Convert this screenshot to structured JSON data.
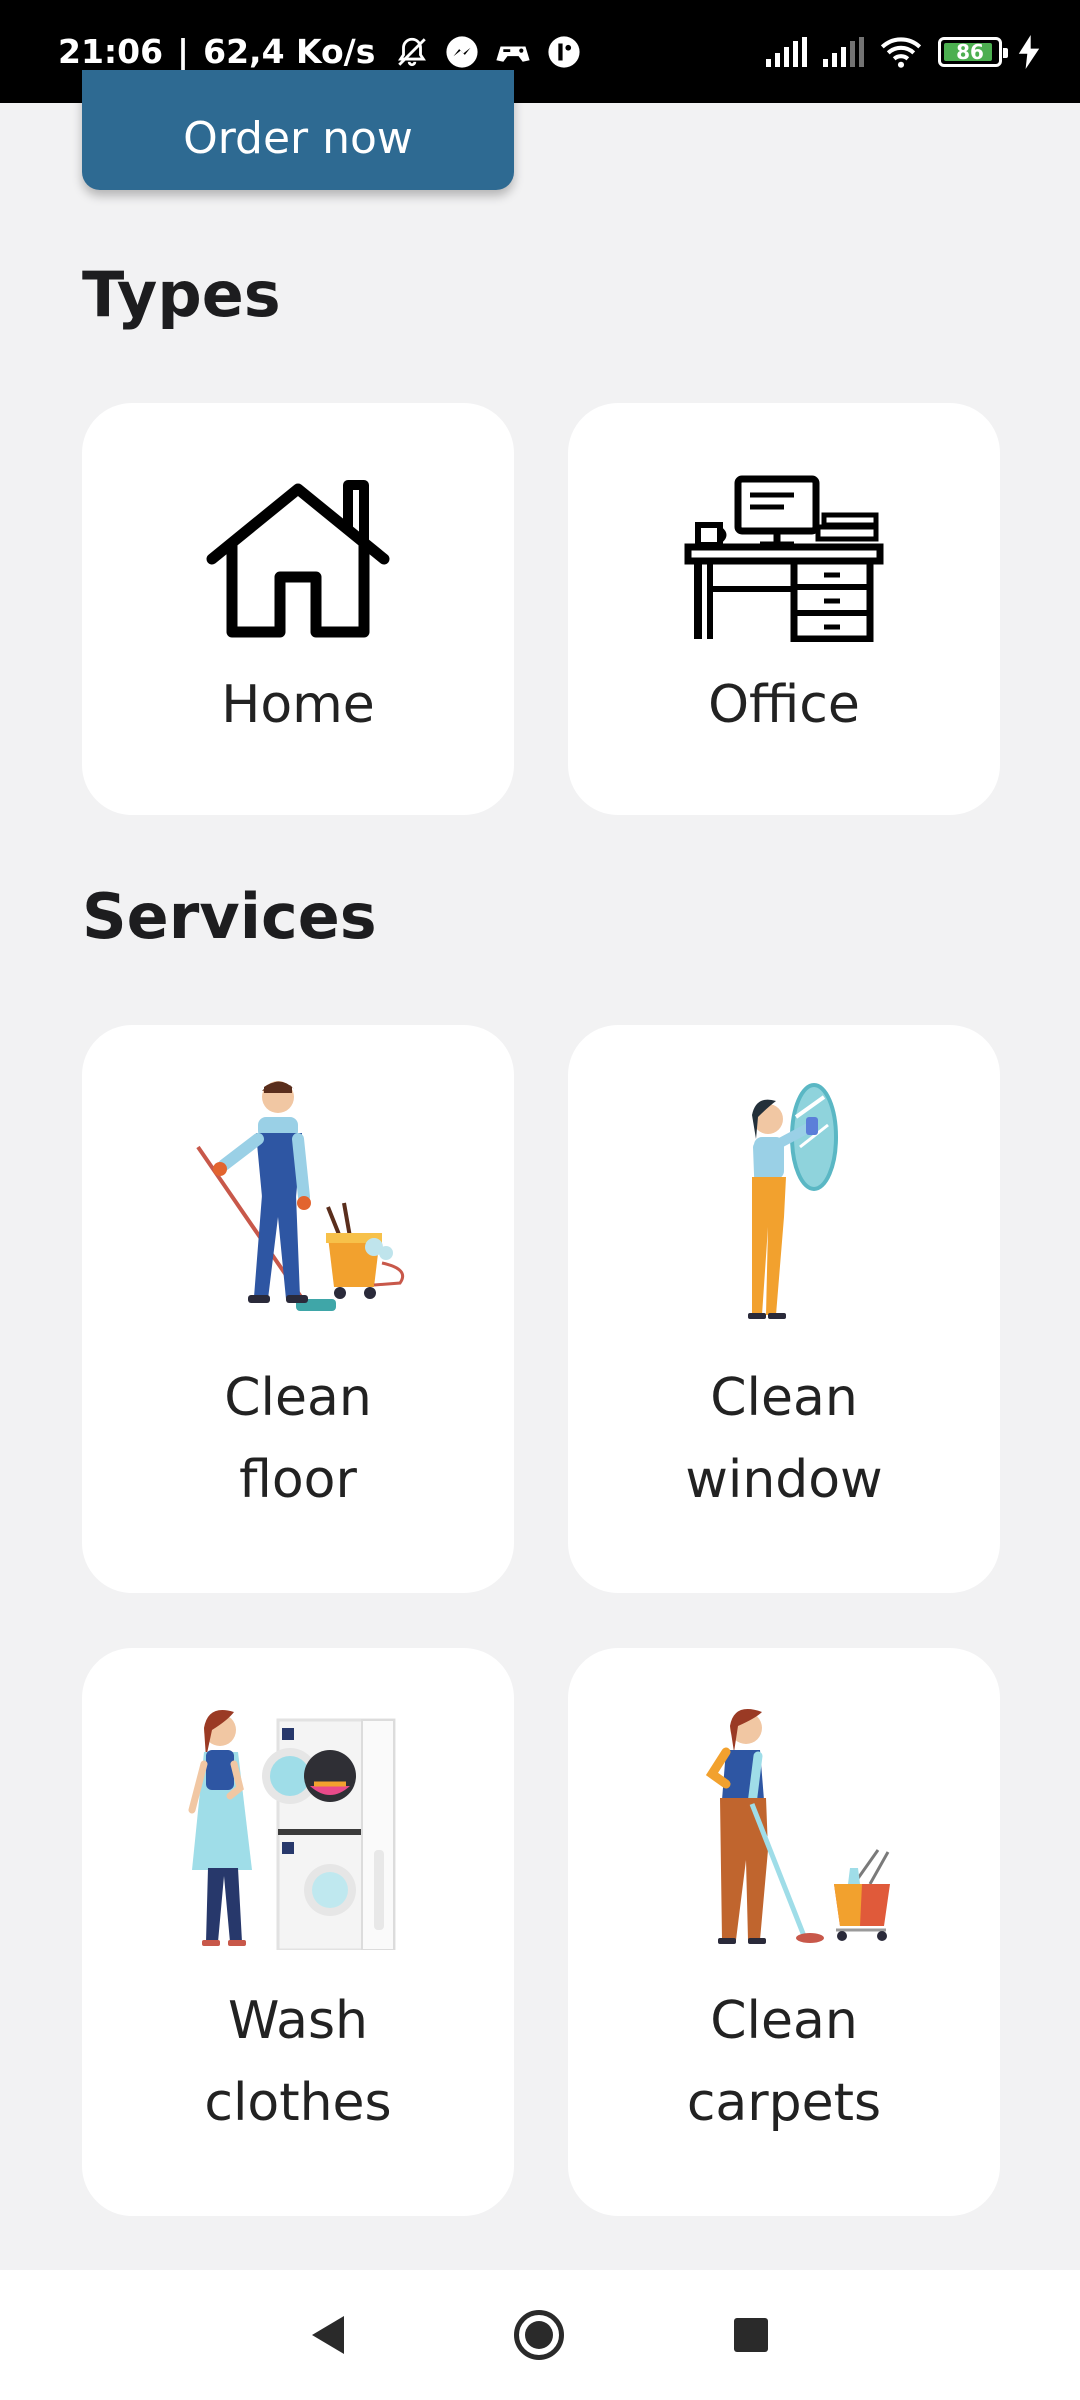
{
  "status_bar": {
    "time": "21:06",
    "separator": "|",
    "speed": "62,4 Ko/s",
    "battery": "86"
  },
  "order_button": {
    "label": "Order now"
  },
  "types": {
    "title": "Types",
    "items": [
      {
        "label": "Home",
        "icon": "house-icon"
      },
      {
        "label": "Office",
        "icon": "office-desk-icon"
      }
    ]
  },
  "services": {
    "title": "Services",
    "items": [
      {
        "label": "Clean\nfloor",
        "illustration": "man-mopping-floor"
      },
      {
        "label": "Clean\nwindow",
        "illustration": "woman-cleaning-window"
      },
      {
        "label": "Wash\nclothes",
        "illustration": "woman-at-washing-machines"
      },
      {
        "label": "Clean\ncarpets",
        "illustration": "woman-cleaning-carpet"
      }
    ]
  },
  "colors": {
    "primary": "#2e6a92",
    "background": "#f2f2f3",
    "card": "#ffffff",
    "battery_fill": "#4caf50"
  }
}
